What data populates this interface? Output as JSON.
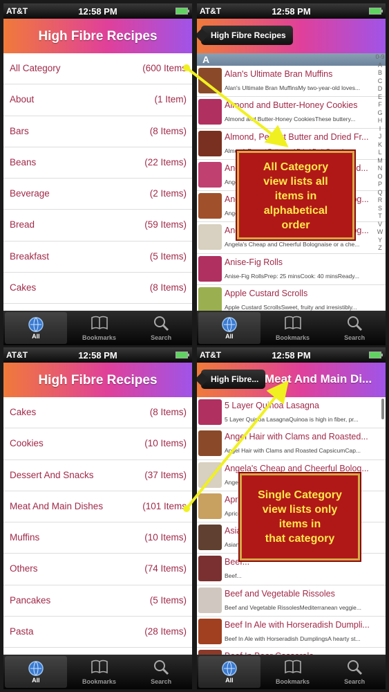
{
  "status": {
    "carrier": "AT&T",
    "time": "12:58 PM"
  },
  "app_title": "High Fibre Recipes",
  "screen1": {
    "categories": [
      {
        "name": "All Category",
        "count": "(600 Items"
      },
      {
        "name": "About",
        "count": "(1 Item)"
      },
      {
        "name": "Bars",
        "count": "(8 Items)"
      },
      {
        "name": "Beans",
        "count": "(22 Items)"
      },
      {
        "name": "Beverage",
        "count": "(2 Items)"
      },
      {
        "name": "Bread",
        "count": "(59 Items)"
      },
      {
        "name": "Breakfast",
        "count": "(5 Items)"
      },
      {
        "name": "Cakes",
        "count": "(8 Items)"
      }
    ]
  },
  "screen2": {
    "back_label": "High Fibre Recipes",
    "section": "A",
    "index_letters": [
      "0-9",
      "A",
      "B",
      "C",
      "D",
      "E",
      "F",
      "G",
      "H",
      "I",
      "J",
      "K",
      "L",
      "M",
      "N",
      "O",
      "P",
      "Q",
      "R",
      "S",
      "T",
      "V",
      "W",
      "Y",
      "Z"
    ],
    "recipes": [
      {
        "title": "Alan's Ultimate Bran Muffins",
        "sub": "Alan's Ultimate Bran MuffinsMy two-year-old loves...",
        "color": "#8a4a2a"
      },
      {
        "title": "Almond and Butter-Honey Cookies",
        "sub": "Almond and Butter-Honey CookiesThese buttery...",
        "color": "#b03060"
      },
      {
        "title": "Almond, Peanut Butter and Dried Fr...",
        "sub": "Almond, Peanut Butter and Dried Fruit Granola...",
        "color": "#7a3020"
      },
      {
        "title": "Angel Hair with Clams and Roasted...",
        "sub": "Angel Hair with Clams and Roasted Capsicum...",
        "color": "#c04070"
      },
      {
        "title": "Angela's Cheap and Cheerful Bolog...",
        "sub": "Angela's Cheap and Cheerful Bolognese...",
        "color": "#a0502a"
      },
      {
        "title": "Angela's Cheap and Cheerful Bolog...",
        "sub": "Angela's Cheap and Cheerful Bolognaise or a che...",
        "color": "#d8d0c0"
      },
      {
        "title": "Anise-Fig Rolls",
        "sub": "Anise-Fig RollsPrep: 25 minsCook: 40 minsReady...",
        "color": "#b03060"
      },
      {
        "title": "Apple Custard Scrolls",
        "sub": "Apple Custard ScrollsSweet, fruity and irresistibly...",
        "color": "#9ab050"
      }
    ]
  },
  "screen3": {
    "categories": [
      {
        "name": "Cakes",
        "count": "(8 Items)"
      },
      {
        "name": "Cookies",
        "count": "(10 Items)"
      },
      {
        "name": "Dessert And Snacks",
        "count": "(37 Items)"
      },
      {
        "name": "Meat And Main Dishes",
        "count": "(101 Items"
      },
      {
        "name": "Muffins",
        "count": "(10 Items)"
      },
      {
        "name": "Others",
        "count": "(74 Items)"
      },
      {
        "name": "Pancakes",
        "count": "(5 Items)"
      },
      {
        "name": "Pasta",
        "count": "(28 Items)"
      }
    ]
  },
  "screen4": {
    "back_label": "High Fibre...",
    "title": "Meat And Main Di...",
    "recipes": [
      {
        "title": "5 Layer Quinoa Lasagna",
        "sub": "5 Layer Quinoa LasagnaQuinoa is high in fiber, pr...",
        "color": "#b03060"
      },
      {
        "title": "Angel Hair with Clams and Roasted...",
        "sub": "Angel Hair with Clams and Roasted CapsicumCap...",
        "color": "#8a4a2a"
      },
      {
        "title": "Angela's Cheap and Cheerful Bolog...",
        "sub": "Angela's Cheap and Cheerful Bolognese...",
        "color": "#d8d0c0"
      },
      {
        "title": "Apricot...",
        "sub": "Apricot...",
        "color": "#c8a060"
      },
      {
        "title": "Asian...",
        "sub": "Asian...",
        "color": "#604030"
      },
      {
        "title": "Beef...",
        "sub": "Beef...",
        "color": "#7a3030"
      },
      {
        "title": "Beef and Vegetable Rissoles",
        "sub": "Beef and Vegetable RissolesMediterranean veggie...",
        "color": "#d0c8c0"
      },
      {
        "title": "Beef In Ale with Horseradish Dumpli...",
        "sub": "Beef In Ale with Horseradish DumplingsA hearty st...",
        "color": "#a04020"
      },
      {
        "title": "Beef In Beer Casserole",
        "sub": "",
        "color": "#8a3a2a"
      }
    ]
  },
  "tabs": [
    {
      "label": "All",
      "icon": "globe-icon"
    },
    {
      "label": "Bookmarks",
      "icon": "book-icon"
    },
    {
      "label": "Search",
      "icon": "search-icon"
    }
  ],
  "overlay1": {
    "lines": [
      "All Category",
      "view lists all",
      "items in",
      "alphabetical",
      "order"
    ]
  },
  "overlay2": {
    "lines": [
      "Single Category",
      "view lists only",
      "items in",
      "that category"
    ]
  },
  "colors": {
    "accent_text": "#a02a4a",
    "overlay_bg": "#b01818",
    "overlay_text": "#ffe84a",
    "arrow": "#f0f020"
  }
}
